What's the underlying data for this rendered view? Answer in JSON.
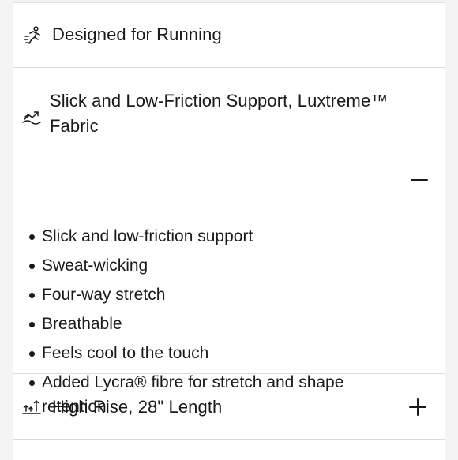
{
  "accordion": {
    "running": {
      "title": "Designed for Running",
      "icon": "running-person-icon"
    },
    "fabric": {
      "title_line1": "Slick and Low-Friction Support, Luxtreme™",
      "title_line2": "Fabric",
      "icon": "glide-trend-icon",
      "toggle": "minus",
      "features": [
        "Slick and low-friction support",
        "Sweat-wicking",
        "Four-way stretch",
        "Breathable",
        "Feels cool to the touch",
        "Added Lycra® fibre for stretch and shape",
        "retention"
      ]
    },
    "rise": {
      "title": "High Rise, 28\" Length",
      "icon": "rise-arrows-icon",
      "toggle": "plus"
    }
  }
}
